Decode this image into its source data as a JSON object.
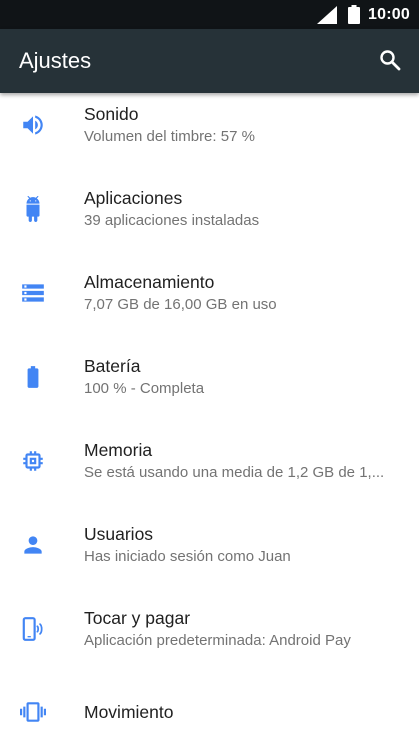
{
  "status_bar": {
    "time": "10:00",
    "signal_icon": "signal-icon",
    "battery_icon": "battery-icon"
  },
  "app_bar": {
    "title": "Ajustes",
    "search_icon": "search-icon"
  },
  "colors": {
    "accent": "#4285F4",
    "appbar": "#263238",
    "statusbar": "#101417"
  },
  "settings": [
    {
      "title": "Sonido",
      "summary": "Volumen del timbre: 57 %",
      "icon": "volume-icon"
    },
    {
      "title": "Aplicaciones",
      "summary": "39 aplicaciones instaladas",
      "icon": "android-icon"
    },
    {
      "title": "Almacenamiento",
      "summary": "7,07 GB de 16,00 GB en uso",
      "icon": "storage-icon"
    },
    {
      "title": "Batería",
      "summary": "100 % - Completa",
      "icon": "battery-icon"
    },
    {
      "title": "Memoria",
      "summary": "Se está usando una media de 1,2 GB de 1,...",
      "icon": "memory-chip-icon"
    },
    {
      "title": "Usuarios",
      "summary": "Has iniciado sesión como Juan",
      "icon": "person-icon"
    },
    {
      "title": "Tocar y pagar",
      "summary": "Aplicación predeterminada: Android Pay",
      "icon": "tap-pay-icon"
    },
    {
      "title": "Movimiento",
      "summary": "",
      "icon": "vibration-icon"
    }
  ]
}
